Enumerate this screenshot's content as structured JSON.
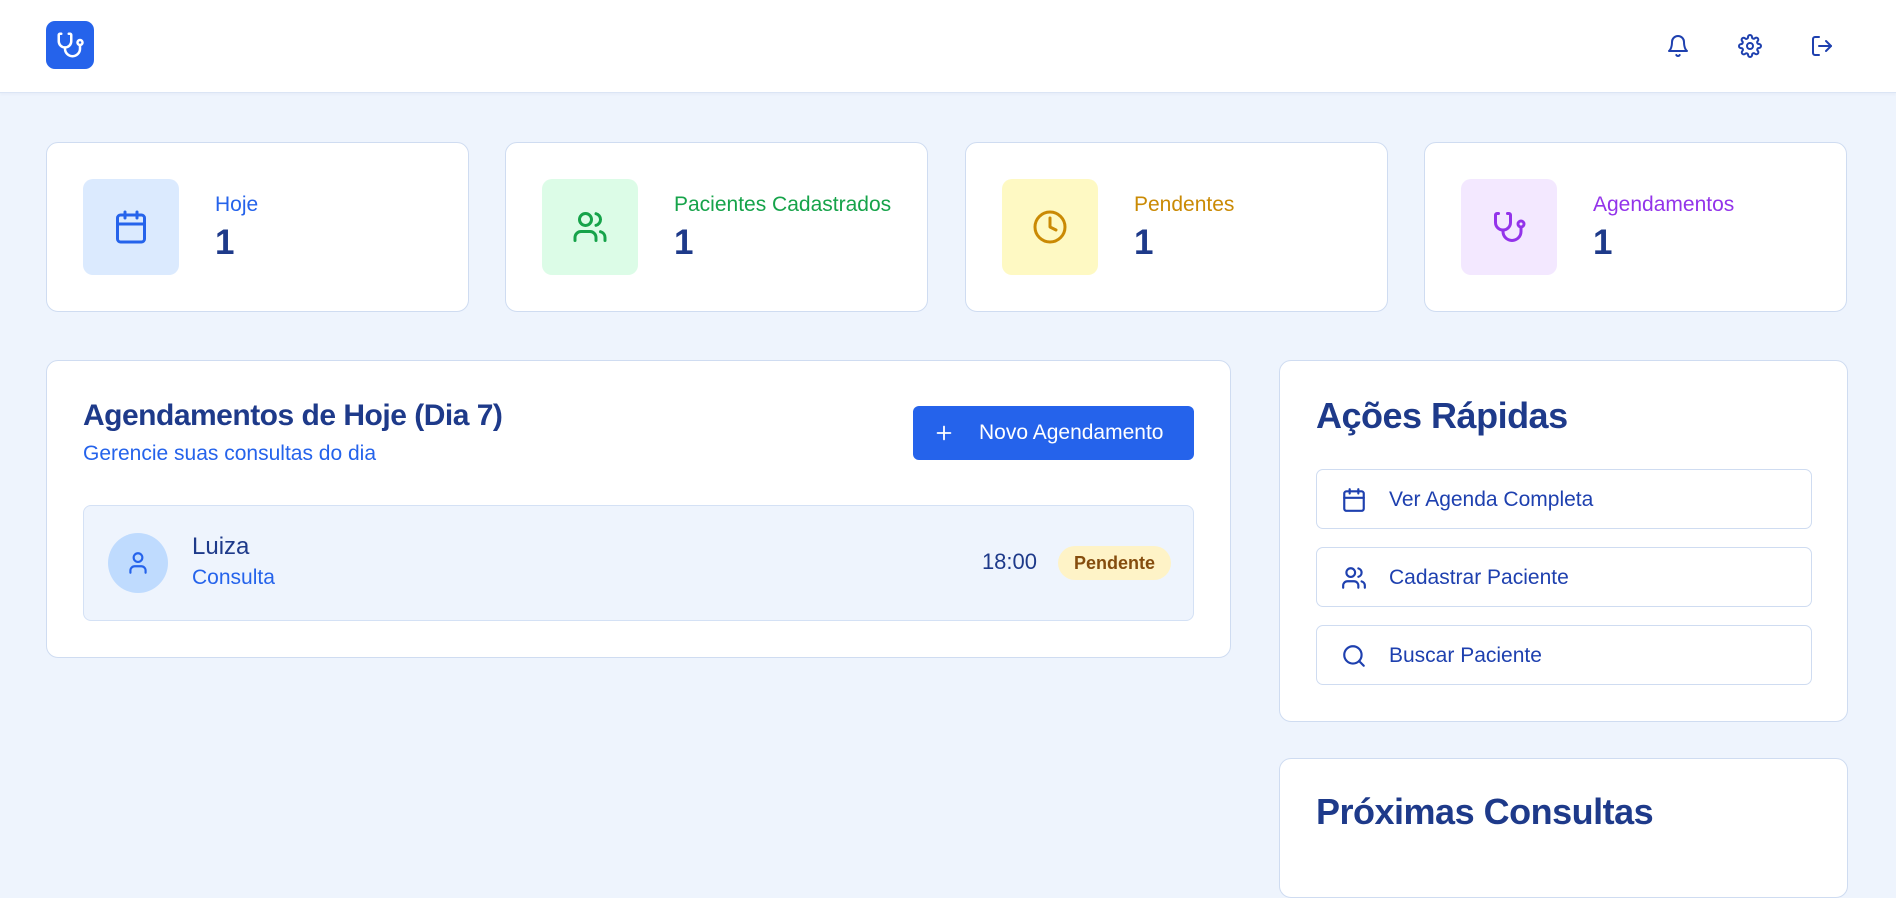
{
  "header": {
    "logo_icon": "stethoscope-icon",
    "actions": [
      {
        "name": "notifications",
        "icon": "bell-icon"
      },
      {
        "name": "settings",
        "icon": "gear-icon"
      },
      {
        "name": "logout",
        "icon": "logout-icon"
      }
    ]
  },
  "stats": [
    {
      "label": "Hoje",
      "value": "1",
      "icon": "calendar-icon",
      "color": "#2563eb",
      "bg": "#dbeafe"
    },
    {
      "label": "Pacientes Cadastrados",
      "value": "1",
      "icon": "users-icon",
      "color": "#16a34a",
      "bg": "#dcfce7"
    },
    {
      "label": "Pendentes",
      "value": "1",
      "icon": "clock-icon",
      "color": "#ca8a04",
      "bg": "#fef9c3"
    },
    {
      "label": "Agendamentos",
      "value": "1",
      "icon": "stethoscope-icon",
      "color": "#9333ea",
      "bg": "#f3e8ff"
    }
  ],
  "appointments": {
    "title": "Agendamentos de Hoje (Dia 7)",
    "subtitle": "Gerencie suas consultas do dia",
    "new_button": "Novo Agendamento",
    "items": [
      {
        "name": "Luiza",
        "type": "Consulta",
        "time": "18:00",
        "status": "Pendente"
      }
    ]
  },
  "quick_actions": {
    "title": "Ações Rápidas",
    "items": [
      {
        "label": "Ver Agenda Completa",
        "icon": "calendar-icon"
      },
      {
        "label": "Cadastrar Paciente",
        "icon": "users-icon"
      },
      {
        "label": "Buscar Paciente",
        "icon": "search-icon"
      }
    ]
  },
  "upcoming": {
    "title": "Próximas Consultas"
  }
}
